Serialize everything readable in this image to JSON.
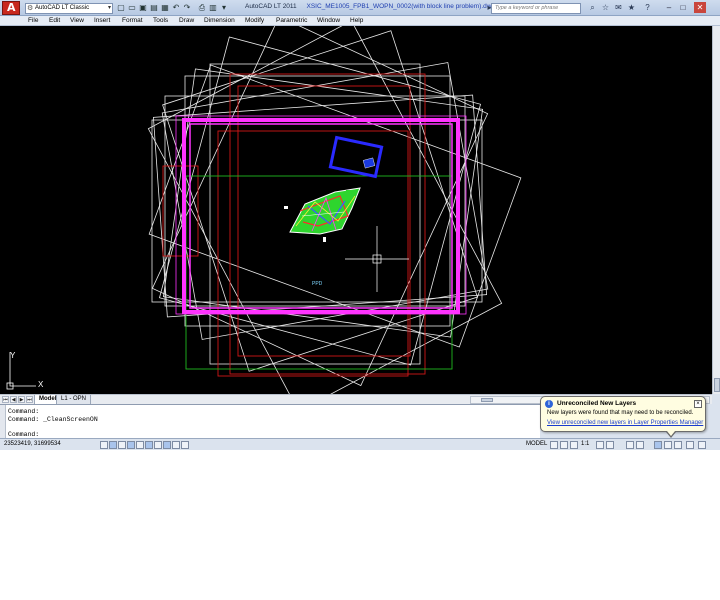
{
  "titlebar": {
    "workspace": "AutoCAD LT Classic",
    "app_name": "AutoCAD LT 2011",
    "document": "XSIC_ME1005_FPB1_WOPN_0002(with block line problem).dwg",
    "search_placeholder": "Type a keyword or phrase"
  },
  "menu": [
    "File",
    "Edit",
    "View",
    "Insert",
    "Format",
    "Tools",
    "Draw",
    "Dimension",
    "Modify",
    "Parametric",
    "Window",
    "Help"
  ],
  "tabs": [
    "Model",
    "L1 - OPN"
  ],
  "command": {
    "lines": [
      "Command:",
      "Command: _CleanScreenON",
      "Command:"
    ]
  },
  "status": {
    "coordinates": "23523419, 31699534",
    "model_label": "MODEL",
    "scale": "1:1"
  },
  "balloon": {
    "title": "Unreconciled New Layers",
    "message": "New layers were found that may need to be reconciled.",
    "link": "View unreconciled new layers in Layer Properties Manager"
  },
  "drawing": {
    "label_small": "PPD",
    "background_color": "#000000",
    "highlight_color": "#ff33ff"
  }
}
